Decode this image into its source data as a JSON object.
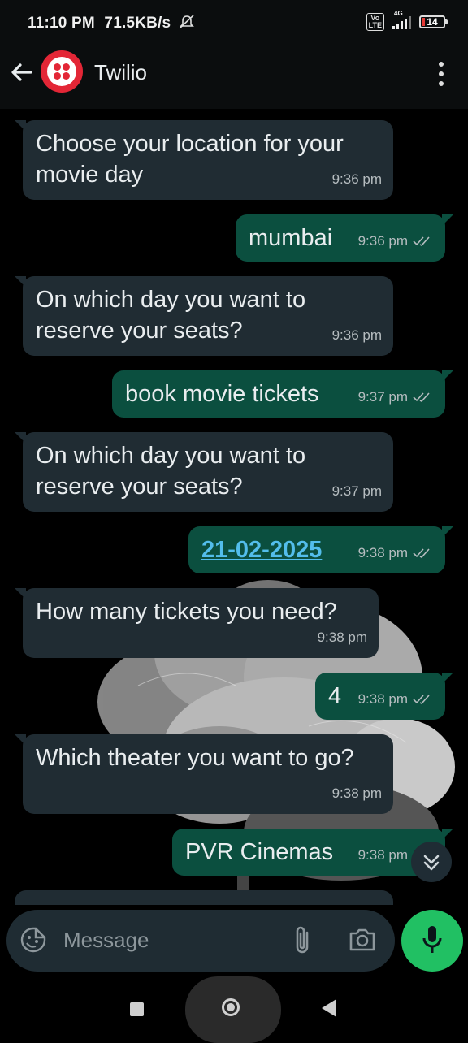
{
  "status_bar": {
    "time": "11:10 PM",
    "speed": "71.5KB/s",
    "volte_label": "Vo LTE",
    "network": "4G",
    "battery": "14"
  },
  "header": {
    "title": "Twilio",
    "brand_color": "#e32636"
  },
  "messages": [
    {
      "dir": "in",
      "text": "Choose your location for your movie day",
      "time": "9:36 pm"
    },
    {
      "dir": "out",
      "text": "mumbai",
      "time": "9:36 pm",
      "status": "read"
    },
    {
      "dir": "in",
      "text": "On which day you want to reserve your seats?",
      "time": "9:36 pm"
    },
    {
      "dir": "out",
      "text": "book movie tickets",
      "time": "9:37 pm",
      "status": "read"
    },
    {
      "dir": "in",
      "text": "On which day you want to reserve your seats?",
      "time": "9:37 pm"
    },
    {
      "dir": "out",
      "text": "21-02-2025",
      "time": "9:38 pm",
      "status": "read",
      "is_link": true
    },
    {
      "dir": "in",
      "text": "How many tickets you need?",
      "time": "9:38 pm"
    },
    {
      "dir": "out",
      "text": "4",
      "time": "9:38 pm",
      "status": "read"
    },
    {
      "dir": "in",
      "text": "Which theater you want to go?",
      "time": "9:38 pm"
    },
    {
      "dir": "out",
      "text": "PVR Cinemas",
      "time": "9:38 pm",
      "status": "read"
    }
  ],
  "input": {
    "placeholder": "Message",
    "value": ""
  },
  "icons": {
    "back": "arrow-left-icon",
    "menu": "more-vert-icon",
    "sticker": "emoji-sticker-icon",
    "attach": "paperclip-icon",
    "camera": "camera-icon",
    "mic": "microphone-icon",
    "scroll": "double-chevron-down-icon"
  },
  "colors": {
    "incoming_bubble": "#202c33",
    "outgoing_bubble": "#0b4f3f",
    "link": "#53bdeb",
    "mic_button": "#21c063"
  }
}
